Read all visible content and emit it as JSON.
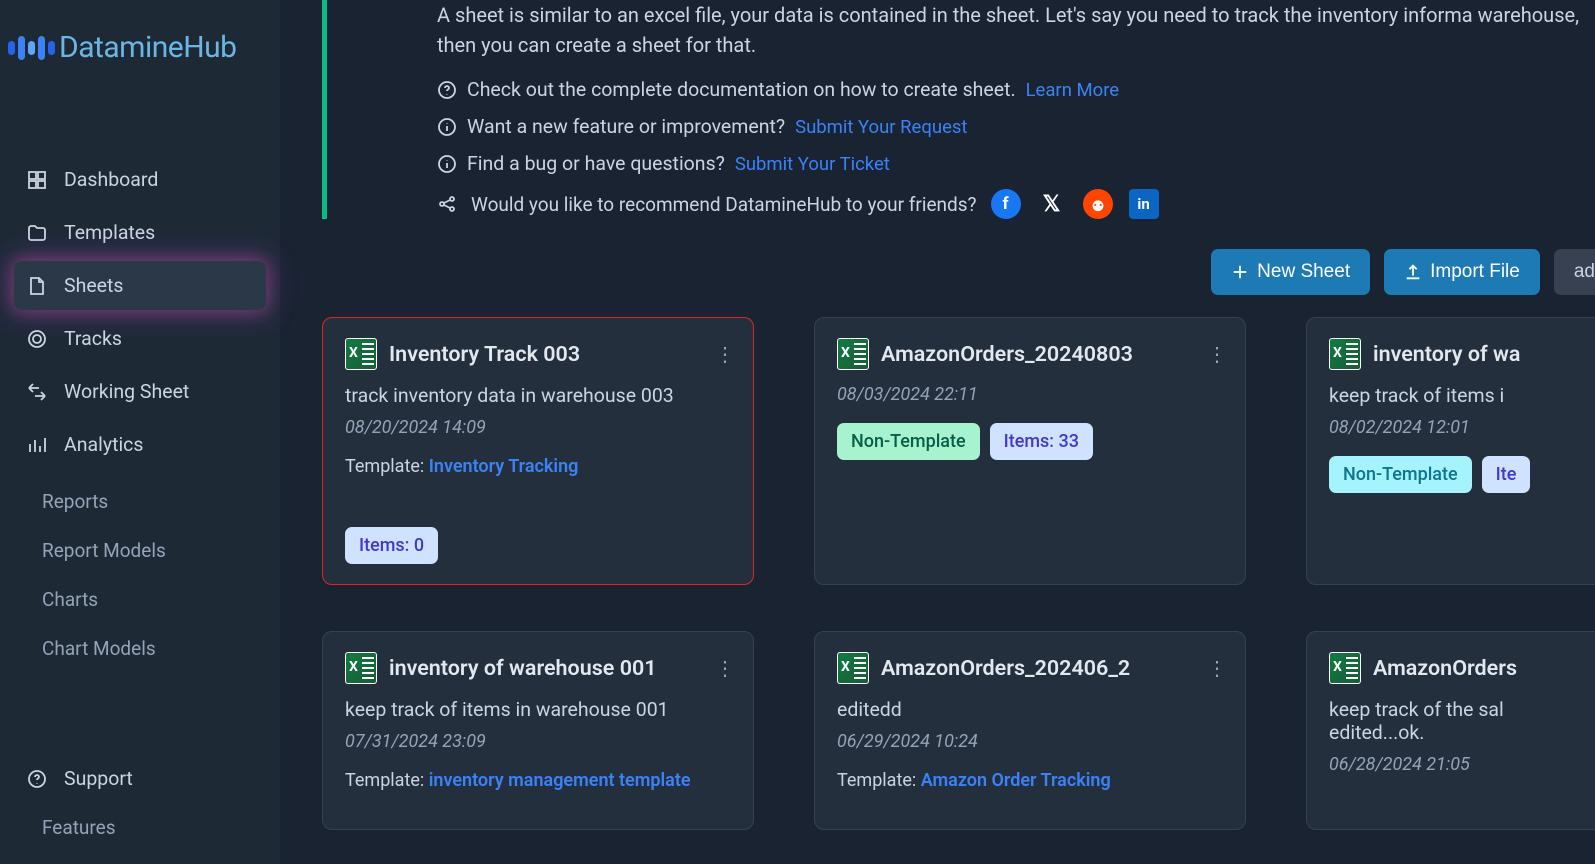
{
  "brand": "DatamineHub",
  "sidebar": {
    "items": [
      {
        "label": "Dashboard",
        "icon": "dashboard"
      },
      {
        "label": "Templates",
        "icon": "folder"
      },
      {
        "label": "Sheets",
        "icon": "file",
        "active": true
      },
      {
        "label": "Tracks",
        "icon": "target"
      },
      {
        "label": "Working Sheet",
        "icon": "flow"
      },
      {
        "label": "Analytics",
        "icon": "chart"
      }
    ],
    "subitems": [
      "Reports",
      "Report Models",
      "Charts",
      "Chart Models"
    ],
    "bottom": [
      {
        "label": "Support",
        "icon": "help"
      },
      {
        "label": "Features"
      }
    ]
  },
  "info": {
    "desc": "A sheet is similar to an excel file, your data is contained in the sheet. Let's say you need to track the inventory informa warehouse, then you can create a sheet for that.",
    "doc_text": "Check out the complete documentation on how to create sheet.",
    "doc_link": "Learn More",
    "feature_text": "Want a new feature or improvement?",
    "feature_link": "Submit Your Request",
    "bug_text": "Find a bug or have questions?",
    "bug_link": "Submit Your Ticket",
    "share_text": "Would you like to recommend DatamineHub to your friends?"
  },
  "toolbar": {
    "new_sheet": "New Sheet",
    "import_file": "Import File",
    "extra": "ad"
  },
  "cards": [
    {
      "title": "Inventory Track 003",
      "desc": "track inventory data in warehouse 003",
      "date": "08/20/2024 14:09",
      "template_label": "Template: ",
      "template": "Inventory Tracking",
      "badges": [
        {
          "text": "Items: 0",
          "cls": "badge-blue"
        }
      ],
      "highlighted": true
    },
    {
      "title": "AmazonOrders_20240803",
      "desc": "",
      "date": "08/03/2024 22:11",
      "badges": [
        {
          "text": "Non-Template",
          "cls": "badge-green"
        },
        {
          "text": "Items: 33",
          "cls": "badge-blue"
        }
      ]
    },
    {
      "title": "inventory of wa",
      "desc": "keep track of items i",
      "date": "08/02/2024 12:01",
      "badges": [
        {
          "text": "Non-Template",
          "cls": "badge-cyan"
        },
        {
          "text": "Ite",
          "cls": "badge-blue"
        }
      ]
    },
    {
      "title": "inventory of warehouse 001",
      "desc": "keep track of items in warehouse 001",
      "date": "07/31/2024 23:09",
      "template_label": "Template: ",
      "template": "inventory management template"
    },
    {
      "title": "AmazonOrders_202406_2",
      "desc": "editedd",
      "date": "06/29/2024 10:24",
      "template_label": "Template: ",
      "template": "Amazon Order Tracking"
    },
    {
      "title": "AmazonOrders",
      "desc": "keep track of the sal edited...ok.",
      "date": "06/28/2024 21:05"
    }
  ]
}
